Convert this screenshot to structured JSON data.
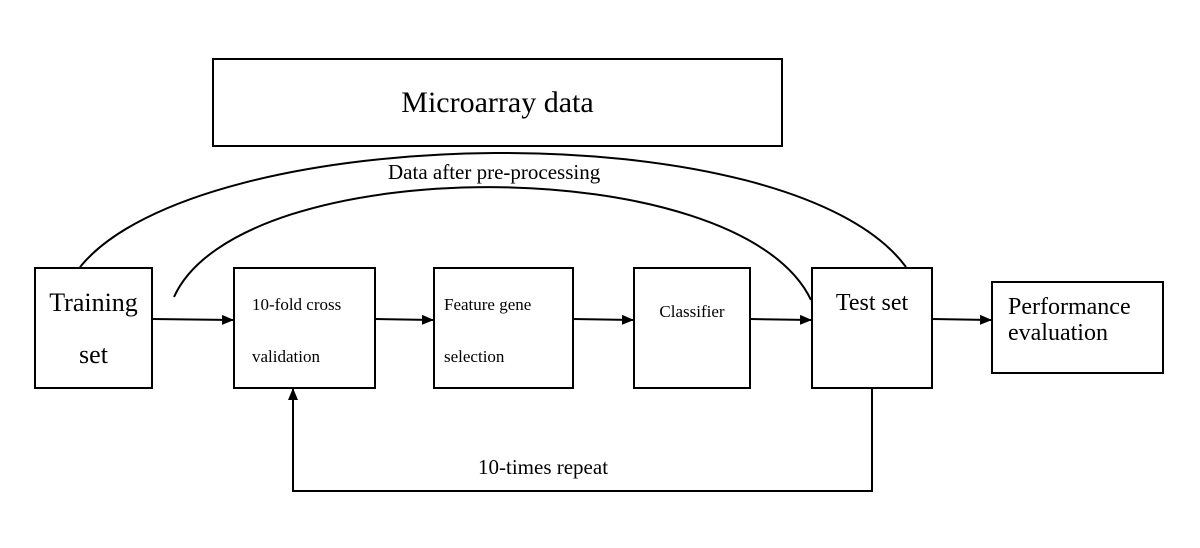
{
  "nodes": {
    "microarray": "Microarray data",
    "training_l1": "Training",
    "training_l2": "set",
    "cv_l1": "10-fold cross",
    "cv_l2": "validation",
    "feature_l1": "Feature gene",
    "feature_l2": "selection",
    "classifier": "Classifier",
    "test": "Test set",
    "perf_l1": "Performance",
    "perf_l2": "evaluation"
  },
  "edges": {
    "preprocessing": "Data after pre-processing",
    "repeat": "10-times repeat"
  }
}
